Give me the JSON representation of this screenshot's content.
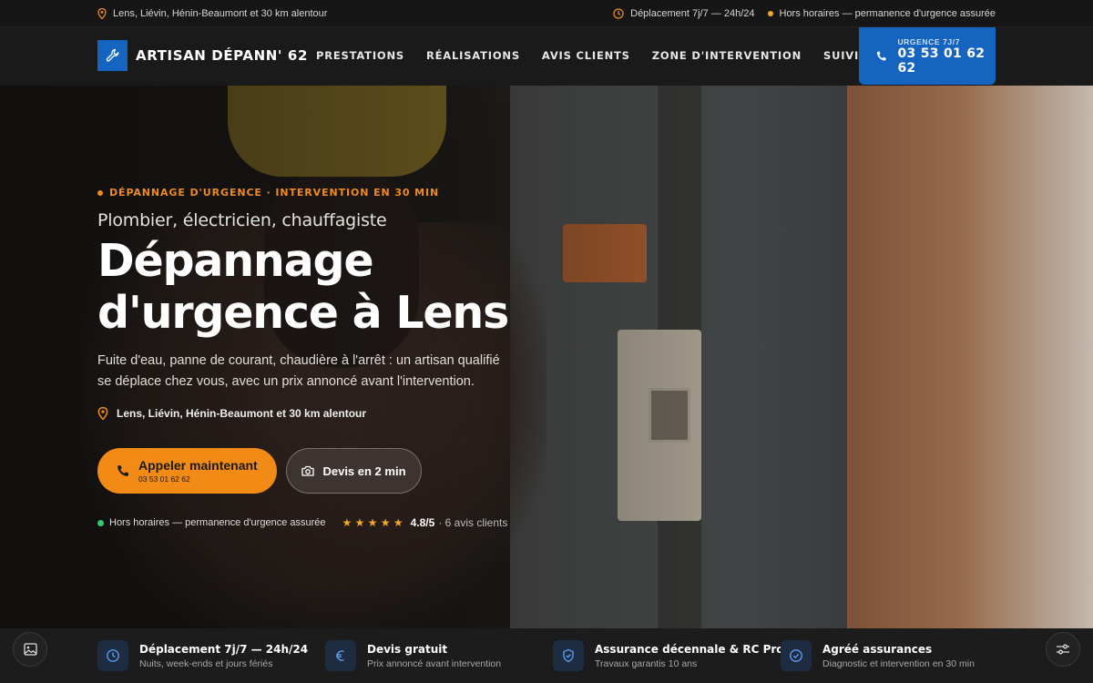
{
  "topbar": {
    "area": "Lens, Liévin, Hénin-Beaumont et 30 km alentour",
    "availability": "Déplacement 7j/7 — 24h/24",
    "after_hours": "Hors horaires — permanence d'urgence assurée"
  },
  "header": {
    "logo_text": "ARTISAN DÉPANN' 62",
    "nav": [
      "PRESTATIONS",
      "RÉALISATIONS",
      "AVIS CLIENTS",
      "ZONE D'INTERVENTION",
      "SUIVI DE DOSSIER"
    ],
    "cta_label": "URGENCE 7J/7",
    "cta_phone": "03 53 01 62 62"
  },
  "hero": {
    "kicker": "DÉPANNAGE D'URGENCE · INTERVENTION EN 30 MIN",
    "subtitle": "Plombier, électricien, chauffagiste",
    "title_line1": "Dépannage",
    "title_line2": "d'urgence à Lens",
    "description": "Fuite d'eau, panne de courant, chaudière à l'arrêt : un artisan qualifié se déplace chez vous, avec un prix annoncé avant l'intervention.",
    "location": "Lens, Liévin, Hénin-Beaumont et 30 km alentour",
    "call_label": "Appeler maintenant",
    "call_phone": "03 53 01 62 62",
    "quote_label": "Devis en 2 min",
    "status": "Hors horaires — permanence d'urgence assurée",
    "stars": "★ ★ ★ ★ ★",
    "rating": "4.8/5",
    "reviews": "· 6 avis clients"
  },
  "features": [
    {
      "title": "Déplacement 7j/7 — 24h/24",
      "sub": "Nuits, week-ends et jours fériés",
      "icon": "clock-icon"
    },
    {
      "title": "Devis gratuit",
      "sub": "Prix annoncé avant intervention",
      "icon": "euro-icon"
    },
    {
      "title": "Assurance décennale & RC Pro",
      "sub": "Travaux garantis 10 ans",
      "icon": "shield-icon"
    },
    {
      "title": "Agréé assurances",
      "sub": "Diagnostic et intervention en 30 min",
      "icon": "check-circle-icon"
    }
  ],
  "colors": {
    "accent": "#f28a16",
    "brand": "#1565c0"
  }
}
